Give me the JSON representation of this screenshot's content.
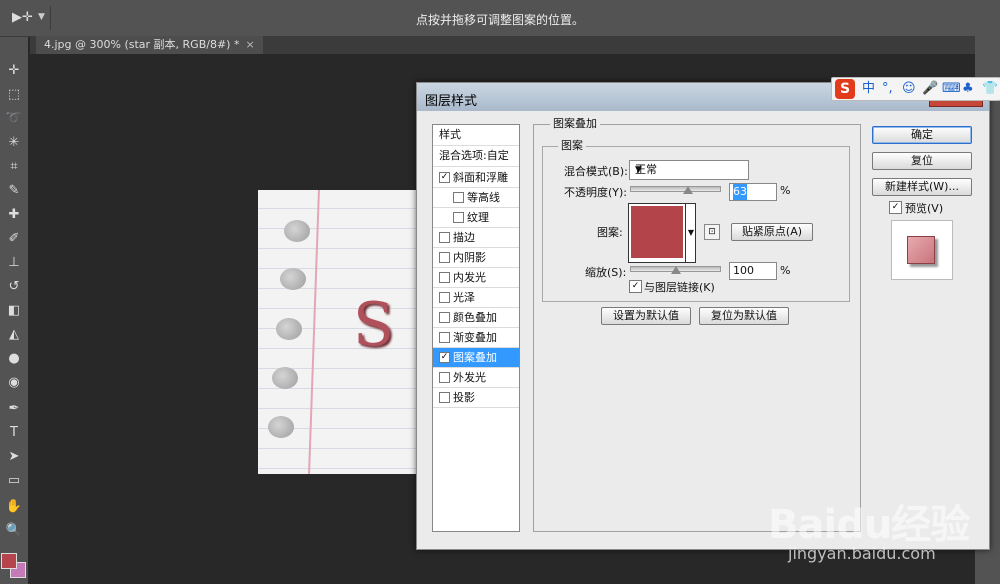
{
  "options_bar": {
    "tool_icon": "move-tool-icon",
    "hint": "点按并拖移可调整图案的位置。"
  },
  "document_tab": {
    "title": "4.jpg @ 300% (star 副本, RGB/8#) *",
    "close": "×"
  },
  "canvas": {
    "letter": "S"
  },
  "toolbar": {
    "icons": [
      "move-icon",
      "marquee-icon",
      "lasso-icon",
      "magic-wand-icon",
      "crop-icon",
      "eyedropper-icon",
      "healing-brush-icon",
      "brush-icon",
      "stamp-icon",
      "history-brush-icon",
      "eraser-icon",
      "paint-bucket-icon",
      "blur-icon",
      "dodge-icon",
      "pen-icon",
      "text-icon",
      "path-select-icon",
      "shape-icon",
      "hand-icon",
      "zoom-icon"
    ],
    "foreground_color": "#b5444c",
    "background_color": "#c47ab6"
  },
  "ime_bar": {
    "logo": "S",
    "items": [
      "中",
      "°,",
      "☺",
      "🎤",
      "⌨",
      "♣",
      "👕"
    ]
  },
  "dialog": {
    "title": "图层样式",
    "styles_list": {
      "header": "样式",
      "blend_options": "混合选项:自定",
      "items": [
        {
          "label": "斜面和浮雕",
          "checked": true
        },
        {
          "label": "等高线",
          "checked": false
        },
        {
          "label": "纹理",
          "checked": false
        },
        {
          "label": "描边",
          "checked": false
        },
        {
          "label": "内阴影",
          "checked": false
        },
        {
          "label": "内发光",
          "checked": false
        },
        {
          "label": "光泽",
          "checked": false
        },
        {
          "label": "颜色叠加",
          "checked": false
        },
        {
          "label": "渐变叠加",
          "checked": false
        },
        {
          "label": "图案叠加",
          "checked": true,
          "selected": true
        },
        {
          "label": "外发光",
          "checked": false
        },
        {
          "label": "投影",
          "checked": false
        }
      ]
    },
    "pattern_overlay": {
      "section_title": "图案叠加",
      "group_title": "图案",
      "blend_mode_label": "混合模式(B):",
      "blend_mode_value": "正常",
      "opacity_label": "不透明度(Y):",
      "opacity_value": "63",
      "opacity_unit": "%",
      "pattern_label": "图案:",
      "pattern_color": "#b2444a",
      "snap_origin_button": "贴紧原点(A)",
      "scale_label": "缩放(S):",
      "scale_value": "100",
      "scale_unit": "%",
      "link_label": "与图层链接(K)",
      "link_checked": true,
      "make_default_button": "设置为默认值",
      "reset_default_button": "复位为默认值"
    },
    "buttons": {
      "ok": "确定",
      "reset": "复位",
      "new_style": "新建样式(W)...",
      "preview_label": "预览(V)"
    }
  },
  "watermark": {
    "brand": "Baidu经验",
    "url": "jingyan.baidu.com"
  }
}
